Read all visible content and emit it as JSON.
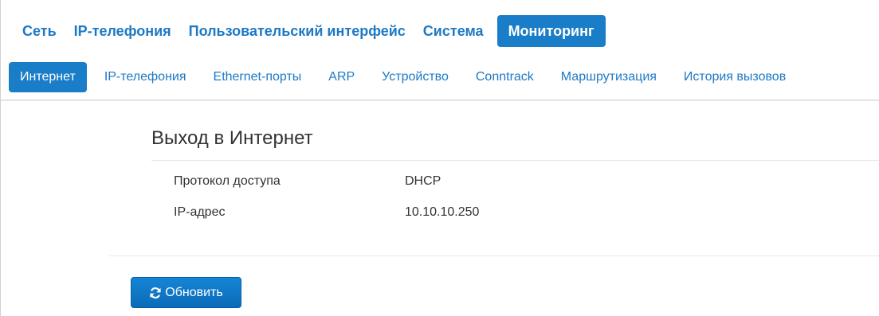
{
  "top_nav": {
    "tabs": [
      {
        "label": "Сеть"
      },
      {
        "label": "IP-телефония"
      },
      {
        "label": "Пользовательский интерфейс"
      },
      {
        "label": "Система"
      },
      {
        "label": "Мониторинг"
      }
    ],
    "active": "Мониторинг"
  },
  "sub_nav": {
    "tabs": [
      {
        "label": "Интернет"
      },
      {
        "label": "IP-телефония"
      },
      {
        "label": "Ethernet-порты"
      },
      {
        "label": "ARP"
      },
      {
        "label": "Устройство"
      },
      {
        "label": "Conntrack"
      },
      {
        "label": "Маршрутизация"
      },
      {
        "label": "История вызовов"
      }
    ],
    "active": "Интернет"
  },
  "panel": {
    "title": "Выход в Интернет",
    "rows": [
      {
        "label": "Протокол доступа",
        "value": "DHCP"
      },
      {
        "label": "IP-адрес",
        "value": "10.10.10.250"
      }
    ]
  },
  "actions": {
    "refresh_label": "Обновить",
    "refresh_icon": "refresh-icon"
  },
  "colors": {
    "accent": "#1a7dc7",
    "link": "#1d79c4",
    "text": "#333333"
  }
}
